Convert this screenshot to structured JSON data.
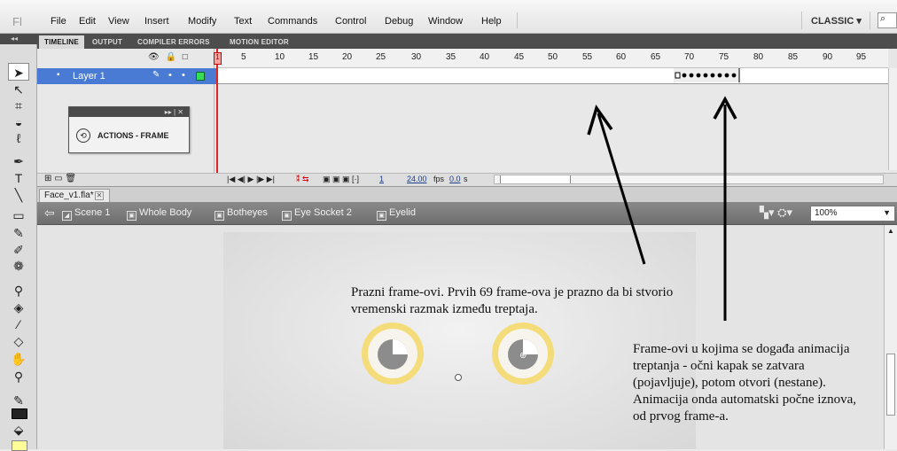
{
  "app": {
    "logo": "Fl"
  },
  "menu": {
    "items": [
      "File",
      "Edit",
      "View",
      "Insert",
      "Modify",
      "Text",
      "Commands",
      "Control",
      "Debug",
      "Window",
      "Help"
    ],
    "workspace": "CLASSIC ▾"
  },
  "panel_tabs": [
    "TIMELINE",
    "OUTPUT",
    "COMPILER ERRORS",
    "MOTION EDITOR"
  ],
  "timeline": {
    "layer_name": "Layer 1",
    "frame_numbers": [
      "5",
      "10",
      "15",
      "20",
      "25",
      "30",
      "35",
      "40",
      "45",
      "50",
      "55",
      "60",
      "65",
      "70",
      "75",
      "80",
      "85",
      "90",
      "95"
    ],
    "current_frame": "1",
    "fps": "24.00",
    "fps_unit": "fps",
    "time": "0.0",
    "time_unit": "s"
  },
  "actions_panel": {
    "label": "ACTIONS - FRAME"
  },
  "document": {
    "tab_name": "Face_v1.fla*"
  },
  "breadcrumb": [
    "Scene 1",
    "Whole Body",
    "Botheyes",
    "Eye Socket 2",
    "Eyelid"
  ],
  "zoom": "100%",
  "annotations": {
    "empty_frames": "Prazni frame-ovi. Prvih 69 frame-ova je prazno da bi stvorio vremenski razmak između treptaja.",
    "anim_frames": "Frame-ovi u kojima se događa animacija treptanja - očni kapak se zatvara (pojavljuje), potom otvori (nestane). Animacija onda automatski počne iznova, od prvog frame-a."
  },
  "colors": {
    "layer_highlight": "#4a7bd4",
    "playhead": "#e02323",
    "eye_ring": "#f5dc7a",
    "eye_gray": "#8c8c8c"
  }
}
